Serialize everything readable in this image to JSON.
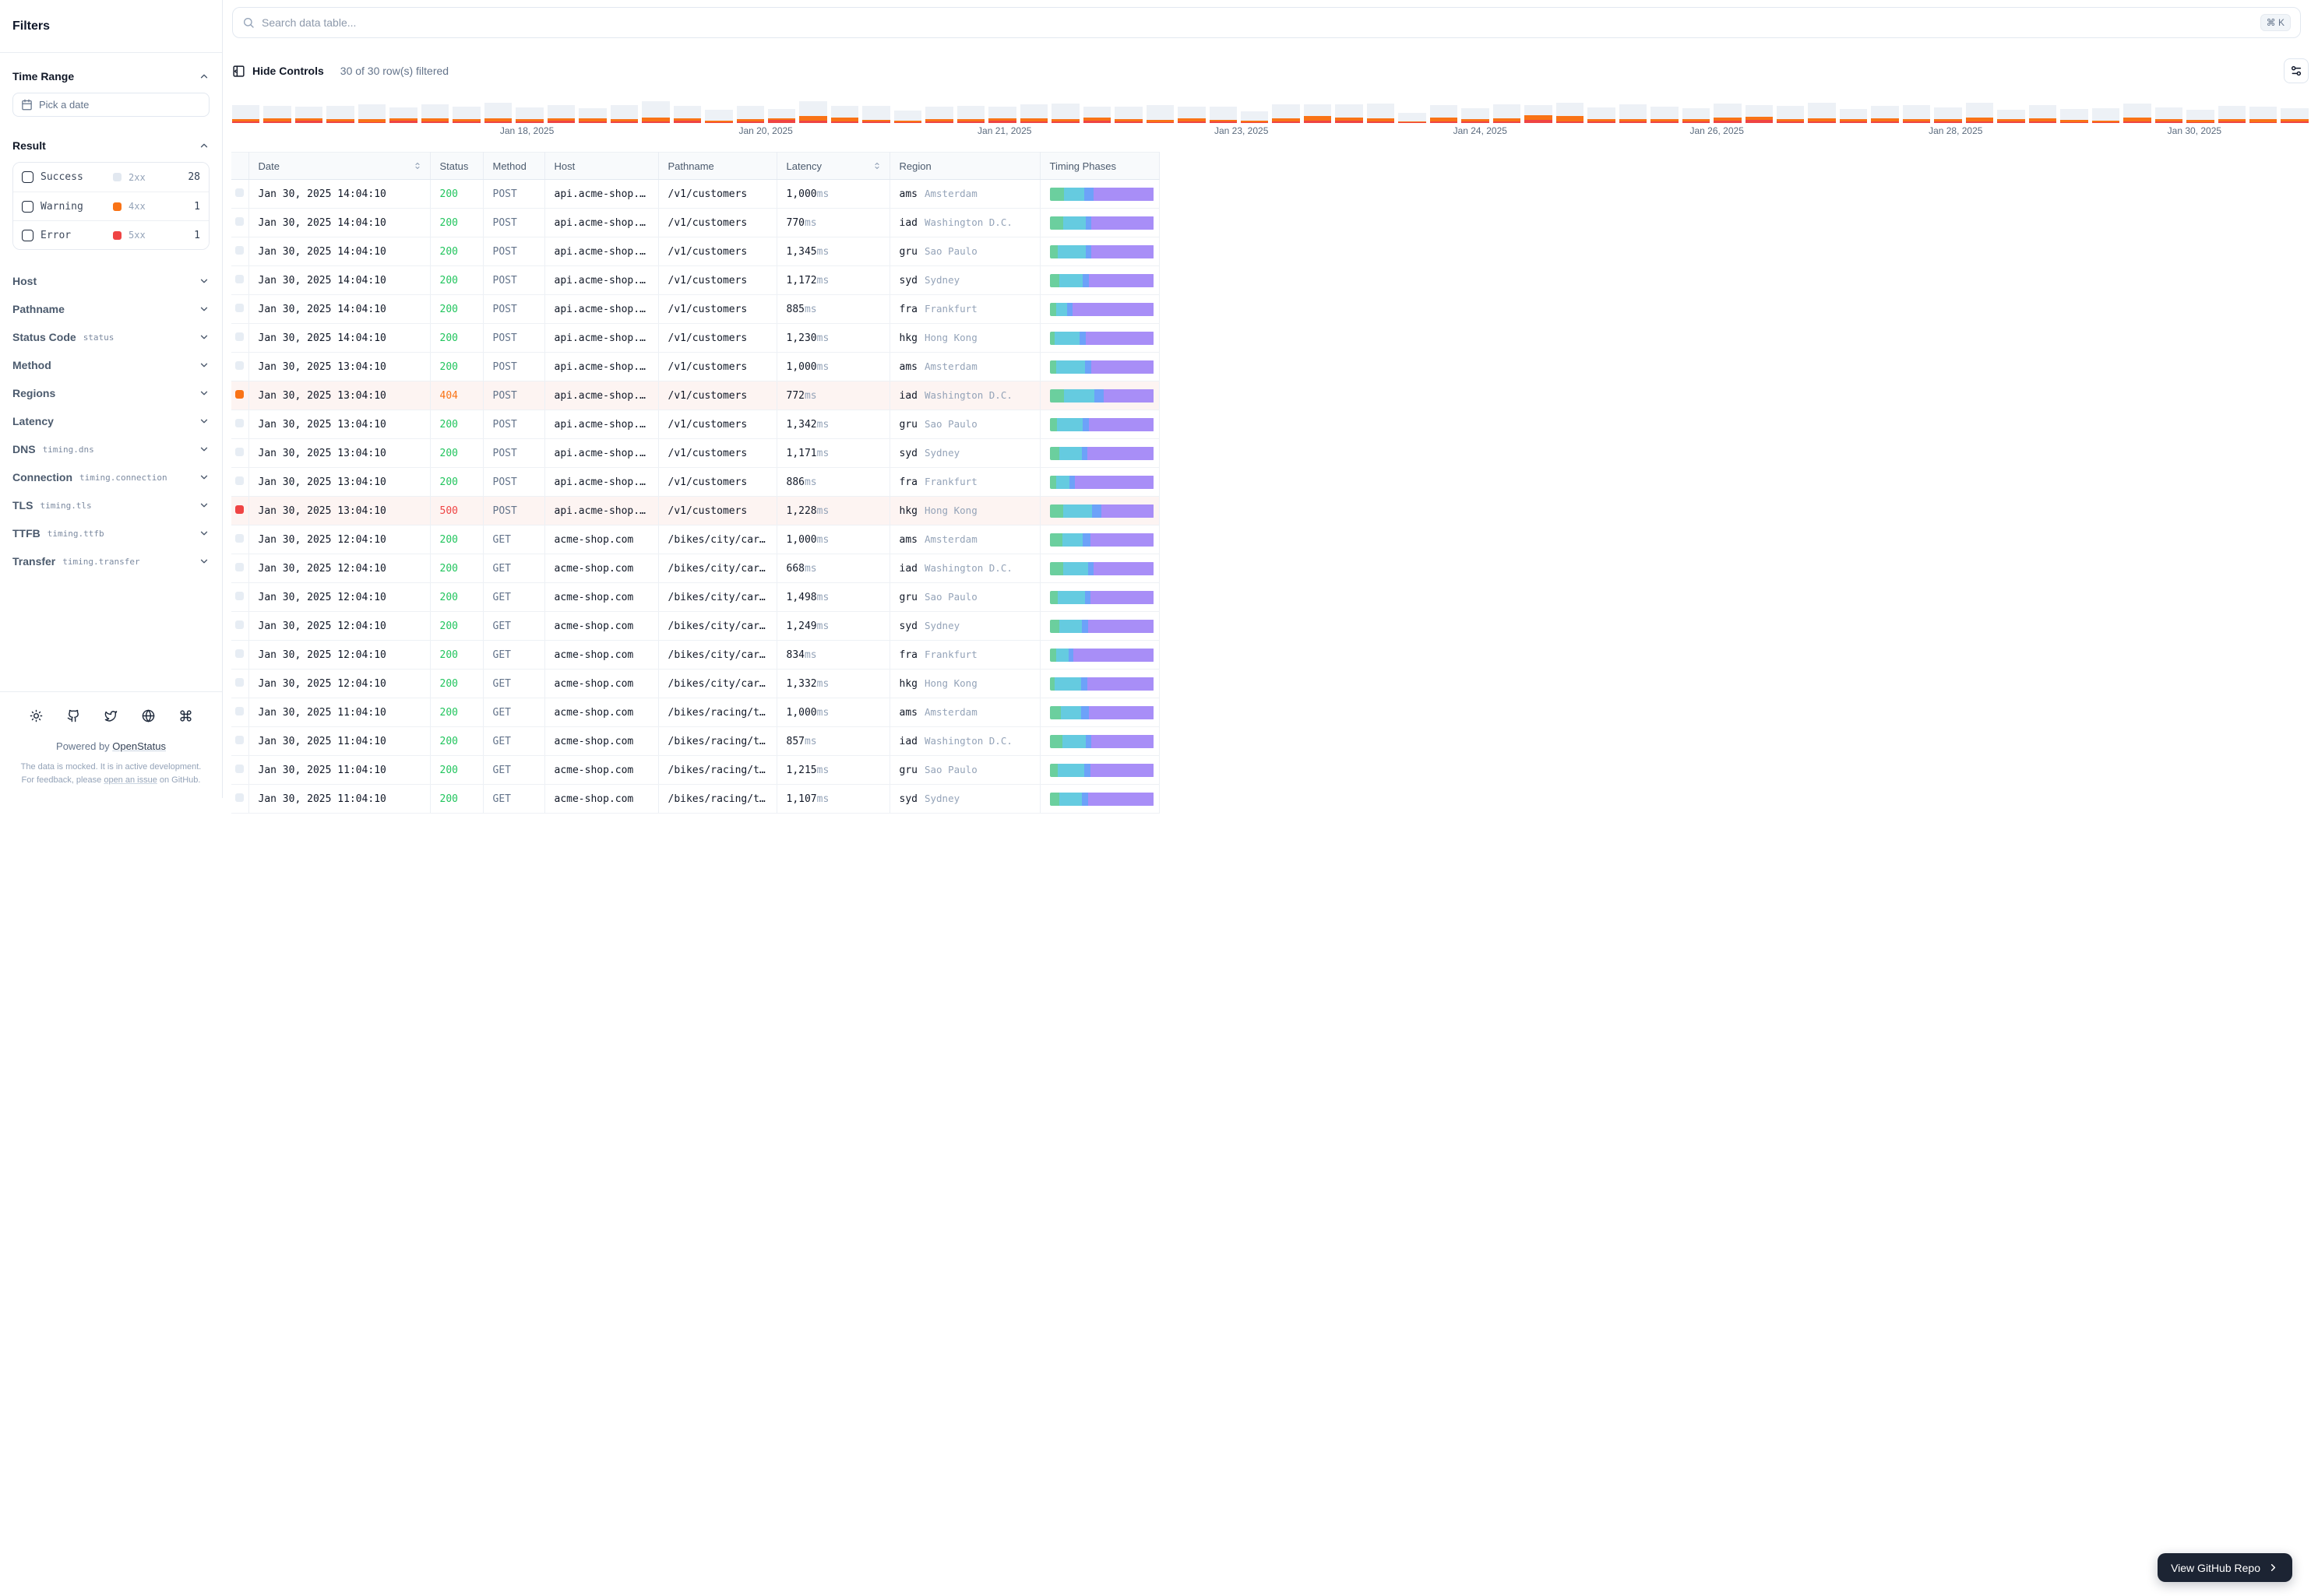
{
  "sidebar": {
    "title": "Filters",
    "time_range": {
      "label": "Time Range",
      "picker_placeholder": "Pick a date"
    },
    "result": {
      "label": "Result",
      "options": [
        {
          "label": "Success",
          "code": "2xx",
          "count": "28",
          "color": "#e2e8f0"
        },
        {
          "label": "Warning",
          "code": "4xx",
          "count": "1",
          "color": "#f97316"
        },
        {
          "label": "Error",
          "code": "5xx",
          "count": "1",
          "color": "#ef4444"
        }
      ]
    },
    "filters": [
      {
        "label": "Host",
        "code": ""
      },
      {
        "label": "Pathname",
        "code": ""
      },
      {
        "label": "Status Code",
        "code": "status"
      },
      {
        "label": "Method",
        "code": ""
      },
      {
        "label": "Regions",
        "code": ""
      },
      {
        "label": "Latency",
        "code": ""
      },
      {
        "label": "DNS",
        "code": "timing.dns"
      },
      {
        "label": "Connection",
        "code": "timing.connection"
      },
      {
        "label": "TLS",
        "code": "timing.tls"
      },
      {
        "label": "TTFB",
        "code": "timing.ttfb"
      },
      {
        "label": "Transfer",
        "code": "timing.transfer"
      }
    ],
    "footer": {
      "icons": [
        "sun",
        "github",
        "twitter",
        "globe",
        "command"
      ],
      "powered_by": "Powered by ",
      "brand": "OpenStatus",
      "note_start": "The data is mocked. It is in active development. For feedback, please ",
      "note_link": "open an issue",
      "note_end": " on GitHub."
    }
  },
  "search": {
    "placeholder": "Search data table...",
    "shortcut": "⌘ K"
  },
  "toolbar": {
    "hide_controls": "Hide Controls",
    "filtered": "30 of 30 row(s) filtered"
  },
  "chart_data": {
    "type": "bar",
    "stacked": true,
    "title": "Requests over time",
    "x_labels": [
      "Jan 18, 2025",
      "Jan 20, 2025",
      "Jan 21, 2025",
      "Jan 23, 2025",
      "Jan 24, 2025",
      "Jan 26, 2025",
      "Jan 28, 2025",
      "Jan 30, 2025"
    ],
    "label_positions_pct": [
      14.2,
      25.7,
      37.2,
      48.6,
      60.1,
      71.5,
      83.0,
      94.5
    ],
    "legend": [
      {
        "name": "success",
        "color": "#edf1f6"
      },
      {
        "name": "4xx",
        "color": "#f97316"
      },
      {
        "name": "5xx",
        "color": "#ef4444"
      }
    ],
    "bars": [
      [
        18,
        3,
        2
      ],
      [
        16,
        4,
        2
      ],
      [
        15,
        3,
        3
      ],
      [
        17,
        3,
        2
      ],
      [
        19,
        4,
        1
      ],
      [
        14,
        3,
        3
      ],
      [
        18,
        4,
        2
      ],
      [
        16,
        3,
        2
      ],
      [
        20,
        4,
        2
      ],
      [
        15,
        3,
        2
      ],
      [
        17,
        3,
        3
      ],
      [
        13,
        4,
        2
      ],
      [
        18,
        3,
        2
      ],
      [
        21,
        5,
        2
      ],
      [
        16,
        3,
        3
      ],
      [
        14,
        2,
        1
      ],
      [
        17,
        3,
        2
      ],
      [
        12,
        2,
        4
      ],
      [
        19,
        6,
        3
      ],
      [
        15,
        5,
        2
      ],
      [
        18,
        2,
        2
      ],
      [
        13,
        2,
        1
      ],
      [
        16,
        3,
        2
      ],
      [
        17,
        3,
        2
      ],
      [
        15,
        3,
        3
      ],
      [
        18,
        4,
        2
      ],
      [
        20,
        3,
        2
      ],
      [
        14,
        4,
        3
      ],
      [
        16,
        3,
        2
      ],
      [
        19,
        3,
        1
      ],
      [
        15,
        4,
        2
      ],
      [
        17,
        2,
        2
      ],
      [
        12,
        2,
        1
      ],
      [
        18,
        4,
        2
      ],
      [
        15,
        6,
        3
      ],
      [
        17,
        4,
        3
      ],
      [
        19,
        4,
        2
      ],
      [
        11,
        1,
        1
      ],
      [
        16,
        5,
        2
      ],
      [
        14,
        3,
        2
      ],
      [
        18,
        4,
        2
      ],
      [
        13,
        6,
        4
      ],
      [
        17,
        7,
        2
      ],
      [
        15,
        3,
        2
      ],
      [
        19,
        3,
        2
      ],
      [
        16,
        3,
        2
      ],
      [
        14,
        3,
        2
      ],
      [
        18,
        4,
        3
      ],
      [
        15,
        4,
        4
      ],
      [
        17,
        3,
        2
      ],
      [
        20,
        4,
        2
      ],
      [
        13,
        3,
        2
      ],
      [
        16,
        4,
        2
      ],
      [
        18,
        3,
        2
      ],
      [
        15,
        3,
        2
      ],
      [
        19,
        5,
        2
      ],
      [
        12,
        3,
        2
      ],
      [
        17,
        4,
        2
      ],
      [
        14,
        3,
        1
      ],
      [
        16,
        2,
        1
      ],
      [
        18,
        5,
        2
      ],
      [
        15,
        3,
        2
      ],
      [
        13,
        3,
        1
      ],
      [
        17,
        3,
        2
      ],
      [
        16,
        4,
        1
      ],
      [
        14,
        3,
        2
      ]
    ]
  },
  "table": {
    "columns": [
      "",
      "Date",
      "Status",
      "Method",
      "Host",
      "Pathname",
      "Latency",
      "Region",
      "Timing Phases"
    ],
    "sortable_columns": [
      "Date",
      "Latency"
    ],
    "timing_phases": {
      "names": [
        "dns",
        "connection",
        "tls",
        "ttfb"
      ],
      "colors": [
        "#6bcf9e",
        "#65cbe0",
        "#6da2f9",
        "#a88ef7"
      ]
    },
    "latency_unit": "ms",
    "rows": [
      {
        "date": "Jan 30, 2025 14:04:10",
        "status": "200",
        "method": "POST",
        "host": "api.acme-shop.…",
        "path": "/v1/customers",
        "latency": "1,000",
        "region": "ams",
        "city": "Amsterdam",
        "level": "ok",
        "timing": [
          14,
          19,
          9,
          58
        ]
      },
      {
        "date": "Jan 30, 2025 14:04:10",
        "status": "200",
        "method": "POST",
        "host": "api.acme-shop.…",
        "path": "/v1/customers",
        "latency": "770",
        "region": "iad",
        "city": "Washington D.C.",
        "level": "ok",
        "timing": [
          13,
          22,
          5,
          60
        ]
      },
      {
        "date": "Jan 30, 2025 14:04:10",
        "status": "200",
        "method": "POST",
        "host": "api.acme-shop.…",
        "path": "/v1/customers",
        "latency": "1,345",
        "region": "gru",
        "city": "Sao Paulo",
        "level": "ok",
        "timing": [
          8,
          27,
          5,
          60
        ]
      },
      {
        "date": "Jan 30, 2025 14:04:10",
        "status": "200",
        "method": "POST",
        "host": "api.acme-shop.…",
        "path": "/v1/customers",
        "latency": "1,172",
        "region": "syd",
        "city": "Sydney",
        "level": "ok",
        "timing": [
          9,
          23,
          6,
          62
        ]
      },
      {
        "date": "Jan 30, 2025 14:04:10",
        "status": "200",
        "method": "POST",
        "host": "api.acme-shop.…",
        "path": "/v1/customers",
        "latency": "885",
        "region": "fra",
        "city": "Frankfurt",
        "level": "ok",
        "timing": [
          6,
          11,
          5,
          78
        ]
      },
      {
        "date": "Jan 30, 2025 14:04:10",
        "status": "200",
        "method": "POST",
        "host": "api.acme-shop.…",
        "path": "/v1/customers",
        "latency": "1,230",
        "region": "hkg",
        "city": "Hong Kong",
        "level": "ok",
        "timing": [
          5,
          24,
          6,
          65
        ]
      },
      {
        "date": "Jan 30, 2025 13:04:10",
        "status": "200",
        "method": "POST",
        "host": "api.acme-shop.…",
        "path": "/v1/customers",
        "latency": "1,000",
        "region": "ams",
        "city": "Amsterdam",
        "level": "ok",
        "timing": [
          6,
          28,
          6,
          60
        ]
      },
      {
        "date": "Jan 30, 2025 13:04:10",
        "status": "404",
        "method": "POST",
        "host": "api.acme-shop.…",
        "path": "/v1/customers",
        "latency": "772",
        "region": "iad",
        "city": "Washington D.C.",
        "level": "warn",
        "timing": [
          14,
          29,
          9,
          48
        ]
      },
      {
        "date": "Jan 30, 2025 13:04:10",
        "status": "200",
        "method": "POST",
        "host": "api.acme-shop.…",
        "path": "/v1/customers",
        "latency": "1,342",
        "region": "gru",
        "city": "Sao Paulo",
        "level": "ok",
        "timing": [
          7,
          25,
          6,
          62
        ]
      },
      {
        "date": "Jan 30, 2025 13:04:10",
        "status": "200",
        "method": "POST",
        "host": "api.acme-shop.…",
        "path": "/v1/customers",
        "latency": "1,171",
        "region": "syd",
        "city": "Sydney",
        "level": "ok",
        "timing": [
          9,
          22,
          5,
          64
        ]
      },
      {
        "date": "Jan 30, 2025 13:04:10",
        "status": "200",
        "method": "POST",
        "host": "api.acme-shop.…",
        "path": "/v1/customers",
        "latency": "886",
        "region": "fra",
        "city": "Frankfurt",
        "level": "ok",
        "timing": [
          6,
          13,
          5,
          76
        ]
      },
      {
        "date": "Jan 30, 2025 13:04:10",
        "status": "500",
        "method": "POST",
        "host": "api.acme-shop.…",
        "path": "/v1/customers",
        "latency": "1,228",
        "region": "hkg",
        "city": "Hong Kong",
        "level": "error",
        "timing": [
          13,
          28,
          9,
          50
        ]
      },
      {
        "date": "Jan 30, 2025 12:04:10",
        "status": "200",
        "method": "GET",
        "host": "acme-shop.com",
        "path": "/bikes/city/car…",
        "latency": "1,000",
        "region": "ams",
        "city": "Amsterdam",
        "level": "ok",
        "timing": [
          12,
          20,
          7,
          61
        ]
      },
      {
        "date": "Jan 30, 2025 12:04:10",
        "status": "200",
        "method": "GET",
        "host": "acme-shop.com",
        "path": "/bikes/city/car…",
        "latency": "668",
        "region": "iad",
        "city": "Washington D.C.",
        "level": "ok",
        "timing": [
          13,
          24,
          5,
          58
        ]
      },
      {
        "date": "Jan 30, 2025 12:04:10",
        "status": "200",
        "method": "GET",
        "host": "acme-shop.com",
        "path": "/bikes/city/car…",
        "latency": "1,498",
        "region": "gru",
        "city": "Sao Paulo",
        "level": "ok",
        "timing": [
          8,
          26,
          5,
          61
        ]
      },
      {
        "date": "Jan 30, 2025 12:04:10",
        "status": "200",
        "method": "GET",
        "host": "acme-shop.com",
        "path": "/bikes/city/car…",
        "latency": "1,249",
        "region": "syd",
        "city": "Sydney",
        "level": "ok",
        "timing": [
          9,
          22,
          6,
          63
        ]
      },
      {
        "date": "Jan 30, 2025 12:04:10",
        "status": "200",
        "method": "GET",
        "host": "acme-shop.com",
        "path": "/bikes/city/car…",
        "latency": "834",
        "region": "fra",
        "city": "Frankfurt",
        "level": "ok",
        "timing": [
          6,
          12,
          5,
          77
        ]
      },
      {
        "date": "Jan 30, 2025 12:04:10",
        "status": "200",
        "method": "GET",
        "host": "acme-shop.com",
        "path": "/bikes/city/car…",
        "latency": "1,332",
        "region": "hkg",
        "city": "Hong Kong",
        "level": "ok",
        "timing": [
          5,
          25,
          6,
          64
        ]
      },
      {
        "date": "Jan 30, 2025 11:04:10",
        "status": "200",
        "method": "GET",
        "host": "acme-shop.com",
        "path": "/bikes/racing/t…",
        "latency": "1,000",
        "region": "ams",
        "city": "Amsterdam",
        "level": "ok",
        "timing": [
          11,
          19,
          8,
          62
        ]
      },
      {
        "date": "Jan 30, 2025 11:04:10",
        "status": "200",
        "method": "GET",
        "host": "acme-shop.com",
        "path": "/bikes/racing/t…",
        "latency": "857",
        "region": "iad",
        "city": "Washington D.C.",
        "level": "ok",
        "timing": [
          12,
          23,
          5,
          60
        ]
      },
      {
        "date": "Jan 30, 2025 11:04:10",
        "status": "200",
        "method": "GET",
        "host": "acme-shop.com",
        "path": "/bikes/racing/t…",
        "latency": "1,215",
        "region": "gru",
        "city": "Sao Paulo",
        "level": "ok",
        "timing": [
          8,
          25,
          6,
          61
        ]
      },
      {
        "date": "Jan 30, 2025 11:04:10",
        "status": "200",
        "method": "GET",
        "host": "acme-shop.com",
        "path": "/bikes/racing/t…",
        "latency": "1,107",
        "region": "syd",
        "city": "Sydney",
        "level": "ok",
        "timing": [
          9,
          22,
          6,
          63
        ]
      }
    ]
  },
  "github_button": {
    "label": "View GitHub Repo"
  }
}
